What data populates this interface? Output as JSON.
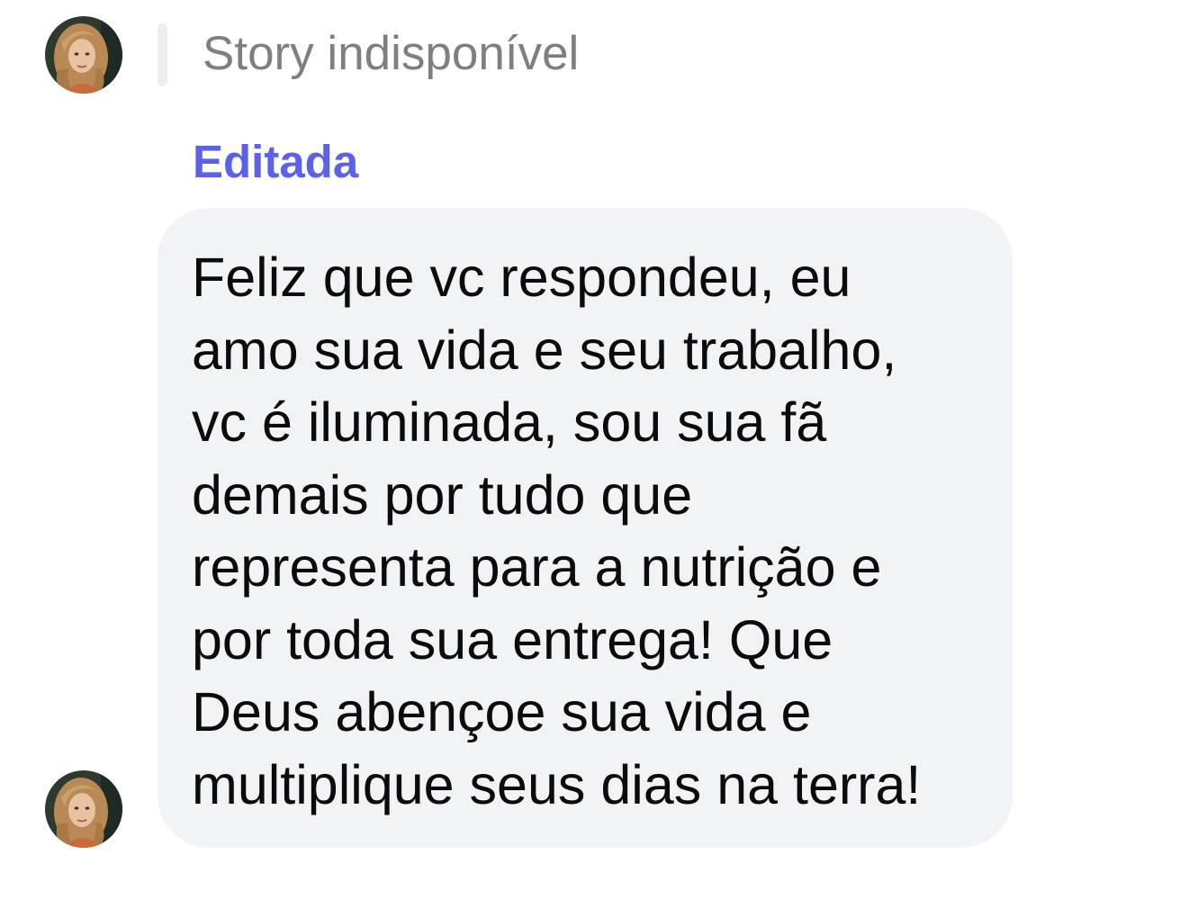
{
  "reply_context": {
    "story_status": "Story indisponível",
    "avatar_icon": "profile-photo-icon"
  },
  "message": {
    "edited_label": "Editada",
    "lines": [
      "Feliz que vc respondeu,  eu",
      "amo sua vida e seu trabalho,",
      "vc é  iluminada, sou sua fã",
      "demais por tudo que",
      "representa para a nutrição e",
      "por toda sua entrega! Que",
      "Deus abençoe sua vida e",
      "multiplique seus dias na terra!"
    ],
    "sender_avatar_icon": "profile-photo-icon"
  },
  "colors": {
    "edited_accent": "#5b62e8",
    "bubble_background": "#f1f3f7",
    "story_text": "#7c7f84",
    "message_text": "#0b0b0c"
  }
}
